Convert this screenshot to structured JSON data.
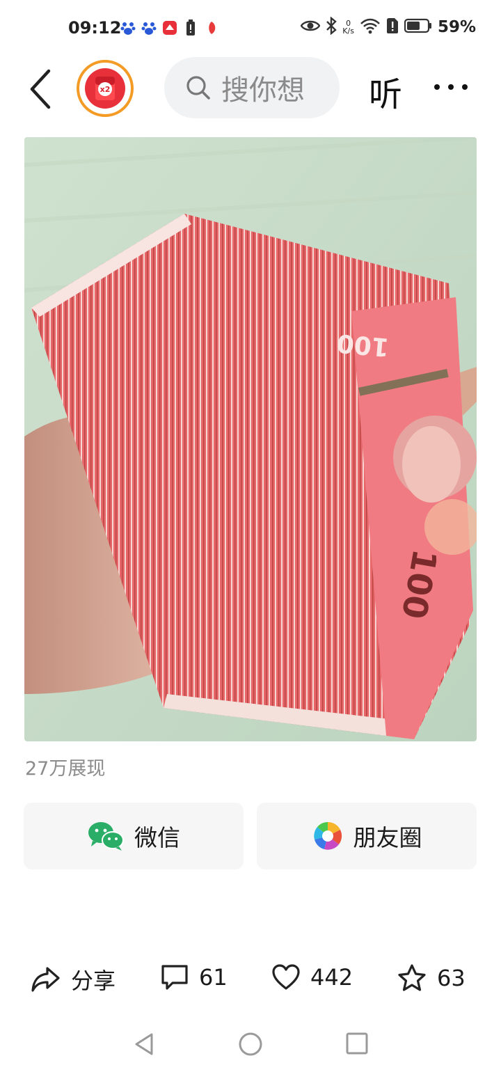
{
  "status_bar": {
    "time": "09:12",
    "net_speed_value": "0",
    "net_speed_unit": "K/s",
    "battery": "59%"
  },
  "top_bar": {
    "avatar_badge": "x2",
    "search_placeholder": "搜你想",
    "listen_label": "听"
  },
  "post": {
    "views": "27万展现"
  },
  "share_targets": [
    {
      "label": "微信"
    },
    {
      "label": "朋友圈"
    }
  ],
  "actions": {
    "share_label": "分享",
    "comments": "61",
    "likes": "442",
    "favorites": "63"
  },
  "colors": {
    "accent_orange": "#f39b25",
    "wechat_green": "#2aae67",
    "banknote_red": "#e4555c"
  }
}
